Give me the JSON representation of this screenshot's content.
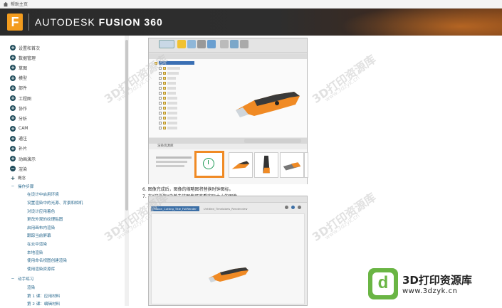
{
  "breadcrumb": {
    "home_label": "帮助主页"
  },
  "header": {
    "brand_prefix": "AUTODESK",
    "brand_product": "FUSION 360",
    "logo_letter": "F"
  },
  "sidebar": {
    "items": [
      {
        "label": "设置和首次"
      },
      {
        "label": "数据管理"
      },
      {
        "label": "草图"
      },
      {
        "label": "模型"
      },
      {
        "label": "部件"
      },
      {
        "label": "工程图"
      },
      {
        "label": "协作"
      },
      {
        "label": "分析"
      },
      {
        "label": "CAM"
      },
      {
        "label": "通注"
      },
      {
        "label": "补片"
      },
      {
        "label": "动画演示"
      },
      {
        "label": "渲染"
      }
    ],
    "render_children": [
      {
        "label": "概念",
        "kind": "plus"
      },
      {
        "label": "操作步骤",
        "kind": "dash"
      }
    ],
    "procedures": [
      "在设计中启用环境",
      "设置渲染中的光源、背景和相机",
      "对设计应用着色",
      "更改外观的纹理贴图",
      "启用画布内渲染",
      "跟踪当前屏幕",
      "在云中渲染",
      "本地渲染",
      "使用命名视图创建渲染",
      "使用渲染资源库"
    ],
    "practice_heading": "动手练习",
    "practice": [
      "渲染",
      "第 1 课：应用材料",
      "第 2 课：编辑材料"
    ]
  },
  "content": {
    "steps": [
      "6. 图像完成后，图像的缩略图将替换时钟图标。",
      "7. 在\"渲染库\"中单击该图像可查看实际大小的图像。"
    ],
    "screenshot1": {
      "gallery_title": "渲染资源库"
    },
    "screenshot2": {
      "tab_active": "Fusion_Cutting_Title_FullRender",
      "tab_inactive": "Untitled_Timelabels_Renderview"
    }
  },
  "watermark": {
    "text": "3D打印资源库",
    "url": "www.3dzyk.cn"
  },
  "colors": {
    "accent": "#f08a24",
    "nav_bullet": "#1f4b5a",
    "link": "#2b6a8f",
    "logo_green": "#6ab544"
  }
}
